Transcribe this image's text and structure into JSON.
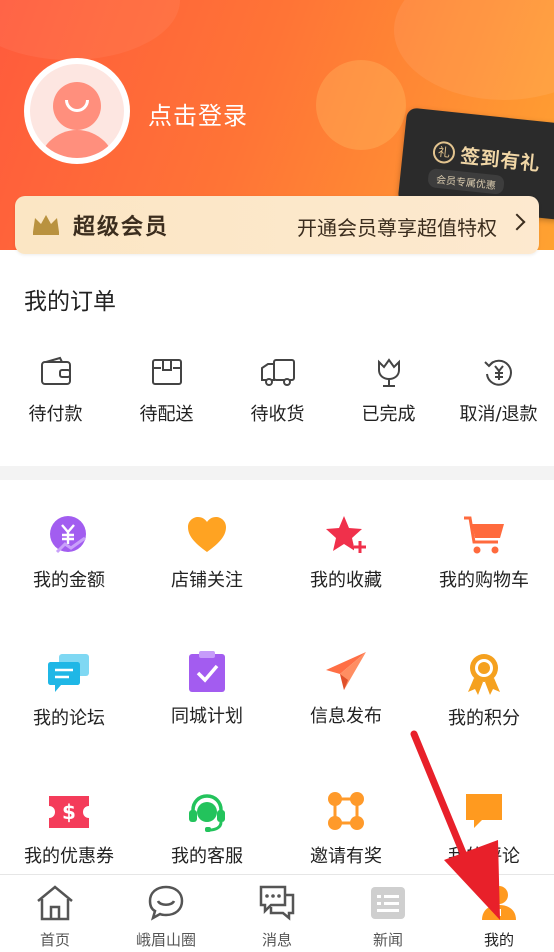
{
  "header": {
    "login_text": "点击登录",
    "sign_card": {
      "title": "签到有礼",
      "subtitle": "会员专属优惠"
    }
  },
  "vip": {
    "title": "超级会员",
    "promo": "开通会员尊享超值特权"
  },
  "orders": {
    "title": "我的订单",
    "items": [
      {
        "label": "待付款",
        "icon": "wallet-icon"
      },
      {
        "label": "待配送",
        "icon": "package-icon"
      },
      {
        "label": "待收货",
        "icon": "truck-icon"
      },
      {
        "label": "已完成",
        "icon": "tulip-icon"
      },
      {
        "label": "取消/退款",
        "icon": "refund-yen-icon"
      }
    ]
  },
  "grid": [
    {
      "label": "我的金额",
      "icon": "yen-coin-icon",
      "color": "#a25df0"
    },
    {
      "label": "店铺关注",
      "icon": "heart-icon",
      "color": "#ffa322"
    },
    {
      "label": "我的收藏",
      "icon": "star-plus-icon",
      "color": "#f0304b"
    },
    {
      "label": "我的购物车",
      "icon": "cart-icon",
      "color": "#ff6a3d"
    },
    {
      "label": "我的论坛",
      "icon": "chat-bubbles-icon",
      "color": "#1fb7e6"
    },
    {
      "label": "同城计划",
      "icon": "clipboard-check-icon",
      "color": "#a35cf0"
    },
    {
      "label": "信息发布",
      "icon": "paper-plane-icon",
      "color": "#ff6f45"
    },
    {
      "label": "我的积分",
      "icon": "medal-icon",
      "color": "#f5a11f"
    },
    {
      "label": "我的优惠券",
      "icon": "coupon-icon",
      "color": "#f43c5a"
    },
    {
      "label": "我的客服",
      "icon": "headset-icon",
      "color": "#23c35c"
    },
    {
      "label": "邀请有奖",
      "icon": "network-icon",
      "color": "#ff9a2a"
    },
    {
      "label": "我的评论",
      "icon": "comment-icon",
      "color": "#ff9a1f"
    }
  ],
  "tabbar": [
    {
      "label": "首页",
      "icon": "home-icon"
    },
    {
      "label": "峨眉山圈",
      "icon": "smile-bubble-icon"
    },
    {
      "label": "消息",
      "icon": "messages-icon"
    },
    {
      "label": "新闻",
      "icon": "news-icon"
    },
    {
      "label": "我的",
      "icon": "user-icon",
      "active": true
    }
  ],
  "colors": {
    "accent": "#ff6b35",
    "active_tab": "#ff9a1f",
    "annotation": "#e8202a"
  }
}
